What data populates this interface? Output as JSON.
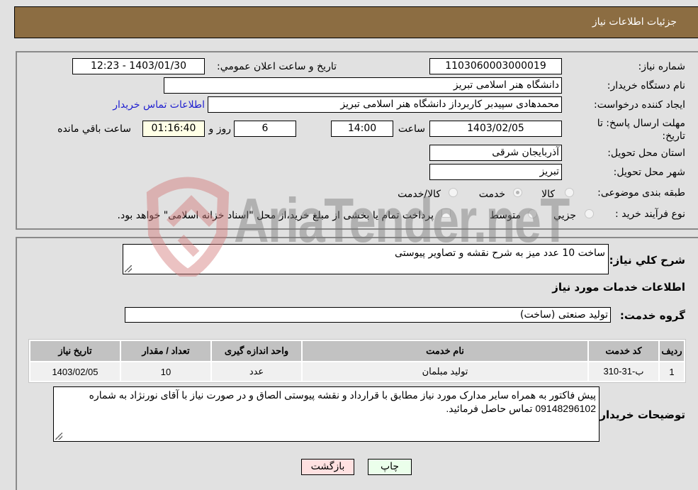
{
  "header": {
    "title": "جزئیات اطلاعات نیاز"
  },
  "details": {
    "need_number_label": "شماره نیاز:",
    "need_number": "1103060003000019",
    "announce_label": "تاریخ و ساعت اعلان عمومي:",
    "announce_value": "1403/01/30 - 12:23",
    "buyer_org_label": "نام دستگاه خریدار:",
    "buyer_org": "دانشگاه هنر اسلامی تبریز",
    "requester_label": "ایجاد کننده درخواست:",
    "requester": "محمدهادی سپیدبر کاربرداز دانشگاه هنر اسلامی تبریز",
    "buyer_contact_link": "اطلاعات تماس خریدار",
    "deadline_label": "مهلت ارسال پاسخ: تا تاریخ:",
    "deadline_date": "1403/02/05",
    "time_label": "ساعت",
    "deadline_time": "14:00",
    "days_value": "6",
    "days_label": "روز و",
    "remaining_time": "01:16:40",
    "remaining_label": "ساعت باقي مانده",
    "province_label": "استان محل تحویل:",
    "province": "آذربایجان شرقی",
    "city_label": "شهر محل تحویل:",
    "city": "تبریز",
    "category_label": "طبقه بندی موضوعی:",
    "category_options": [
      {
        "label": "کالا",
        "checked": false
      },
      {
        "label": "خدمت",
        "checked": true
      },
      {
        "label": "کالا/خدمت",
        "checked": false
      }
    ],
    "purchase_type_label": "نوع فرآیند خرید :",
    "purchase_type_options": [
      {
        "label": "جزیي",
        "checked": false
      },
      {
        "label": "متوسط",
        "checked": false
      }
    ],
    "treasury_note": "پرداخت تمام یا بخشی از مبلغ خرید،از محل \"اسناد خزانه اسلامی\" خواهد بود."
  },
  "summary": {
    "description_label": "شرح کلي نیاز:",
    "description": "ساخت 10 عدد میز به شرح نقشه و تصاویر پیوستی",
    "services_heading": "اطلاعات خدمات مورد نیاز",
    "service_group_label": "گروه خدمت:",
    "service_group": "تولید صنعتی (ساخت)"
  },
  "table": {
    "headers": [
      "ردیف",
      "کد خدمت",
      "نام خدمت",
      "واحد اندازه گیری",
      "تعداد / مقدار",
      "تاریخ نیاز"
    ],
    "rows": [
      [
        "1",
        "ب-31-310",
        "تولید مبلمان",
        "عدد",
        "10",
        "1403/02/05"
      ]
    ]
  },
  "buyer_notes": {
    "label": "توضیحات خریدار:",
    "text": "پیش فاکتور به همراه سایر مدارک مورد نیاز مطابق با قرارداد و نقشه پیوستی الصاق و در صورت نیاز با آقای نورنژاد به شماره 09148296102 تماس حاصل فرمائید."
  },
  "buttons": {
    "print": "چاپ",
    "back": "بازگشت"
  },
  "watermark": {
    "text": "AriaTender.neT"
  }
}
